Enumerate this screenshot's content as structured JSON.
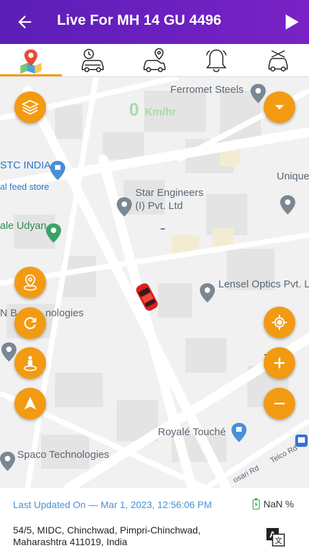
{
  "header": {
    "title": "Live For MH 14 GU 4496",
    "back_icon": "arrow-left-icon",
    "play_icon": "play-icon",
    "gradient_start": "#5b1fb6",
    "gradient_end": "#7a22c6"
  },
  "tabs": [
    {
      "name": "live-map",
      "icon": "map-pin-icon",
      "active": true
    },
    {
      "name": "trip-history",
      "icon": "clock-car-icon",
      "active": false
    },
    {
      "name": "car-location",
      "icon": "car-pin-icon",
      "active": false
    },
    {
      "name": "alerts",
      "icon": "bell-icon",
      "active": false
    },
    {
      "name": "car-service",
      "icon": "car-tools-icon",
      "active": false
    }
  ],
  "speed": {
    "value": "0",
    "unit": "Km/hr"
  },
  "map": {
    "pois": [
      {
        "label": "Ferromet Steels"
      },
      {
        "label": "STC INDIA"
      },
      {
        "label": "al feed store"
      },
      {
        "label": "Unique"
      },
      {
        "label": "Star Engineers"
      },
      {
        "label": "(I) Pvt. Ltd"
      },
      {
        "label": "ale Udyan"
      },
      {
        "label": "Lensel Optics Pvt. L"
      },
      {
        "label": "N B"
      },
      {
        "label": "nologies"
      },
      {
        "label": "Royalé Touché"
      },
      {
        "label": "Spaco Technologies"
      },
      {
        "label": "Telco Rd"
      },
      {
        "label": "osari Rd"
      }
    ]
  },
  "buttons": {
    "left": [
      "layers-icon",
      "location-pin-circle-icon",
      "refresh-icon",
      "street-view-icon",
      "navigation-arrow-icon"
    ],
    "right": [
      "dropdown-chevron-icon",
      "gps-target-icon",
      "zoom-in-icon",
      "zoom-out-icon"
    ],
    "accent": "#f29b12"
  },
  "footer": {
    "last_updated": "Last Updated On — Mar 1, 2023, 12:56:06 PM",
    "battery": "NaN %",
    "address": "54/5, MIDC, Chinchwad, Pimpri-Chinchwad, Maharashtra 411019, India",
    "translate_icon": "translate-icon"
  }
}
